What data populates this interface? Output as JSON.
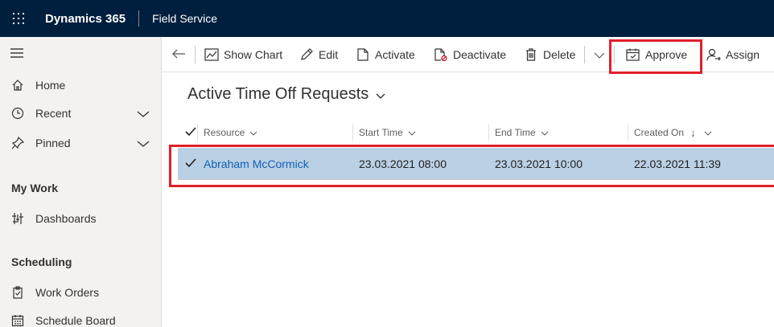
{
  "header": {
    "brand": "Dynamics 365",
    "app_name": "Field Service"
  },
  "sidebar": {
    "items": [
      {
        "label": "Home",
        "icon": "home-icon"
      },
      {
        "label": "Recent",
        "icon": "clock-icon"
      },
      {
        "label": "Pinned",
        "icon": "pin-icon"
      }
    ],
    "sections": [
      {
        "title": "My Work",
        "items": [
          {
            "label": "Dashboards",
            "icon": "dashboard-icon"
          }
        ]
      },
      {
        "title": "Scheduling",
        "items": [
          {
            "label": "Work Orders",
            "icon": "clipboard-icon"
          },
          {
            "label": "Schedule Board",
            "icon": "calendar-icon"
          }
        ]
      }
    ]
  },
  "commandbar": {
    "show_chart": "Show Chart",
    "edit": "Edit",
    "activate": "Activate",
    "deactivate": "Deactivate",
    "delete": "Delete",
    "approve": "Approve",
    "assign": "Assign"
  },
  "view": {
    "title": "Active Time Off Requests"
  },
  "grid": {
    "columns": [
      "Resource",
      "Start Time",
      "End Time",
      "Created On"
    ],
    "sort_indicator": "↓",
    "rows": [
      {
        "resource": "Abraham McCormick",
        "start": "23.03.2021 08:00",
        "end": "23.03.2021 10:00",
        "created": "22.03.2021 11:39",
        "selected": true
      }
    ]
  },
  "colors": {
    "topbar": "#001f3f",
    "highlight": "#e0202a",
    "selected_row": "#bad0e4",
    "link": "#1160b7"
  }
}
